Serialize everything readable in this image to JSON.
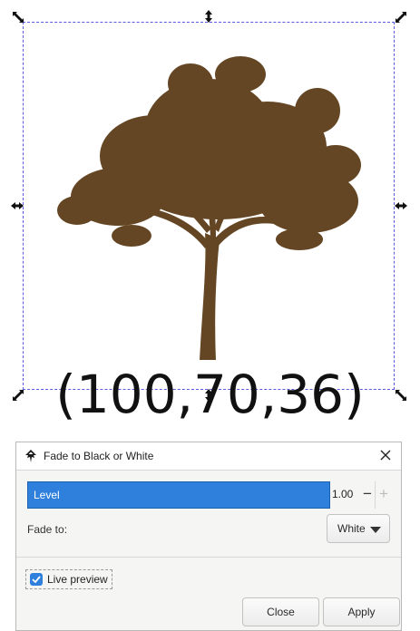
{
  "canvas": {
    "rgb_text": "(100,70,36)",
    "tree_color": "#644624",
    "selection_color": "#5a5ae0"
  },
  "dialog": {
    "title": "Fade to Black or White",
    "app_icon": "inkscape-icon",
    "close_icon": "close-icon",
    "level": {
      "label": "Level",
      "value": "1.00",
      "minus": "−",
      "plus": "+",
      "fill_fraction": 1.0
    },
    "fade_to": {
      "label": "Fade to:",
      "selected": "White"
    },
    "live_preview": {
      "label": "Live preview",
      "checked": true
    },
    "buttons": {
      "close": "Close",
      "apply": "Apply"
    },
    "accent_color": "#2f7fdc"
  }
}
